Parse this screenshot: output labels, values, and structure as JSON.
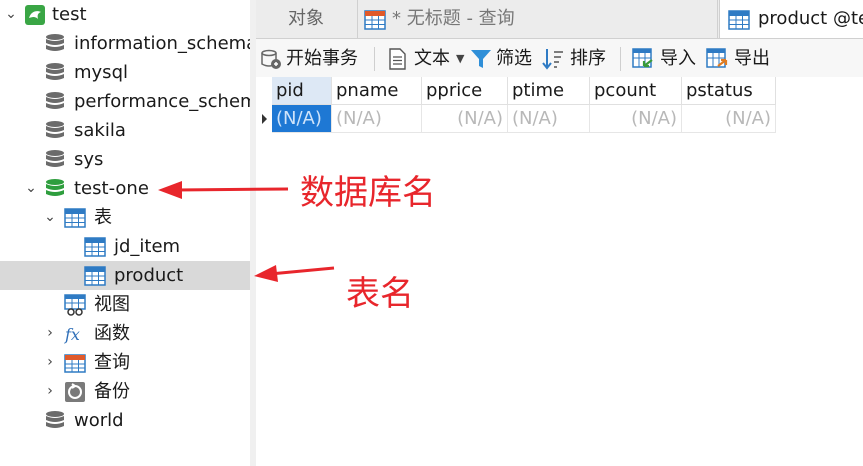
{
  "sidebar": {
    "items": [
      {
        "label": "test"
      },
      {
        "label": "information_schema"
      },
      {
        "label": "mysql"
      },
      {
        "label": "performance_schema"
      },
      {
        "label": "sakila"
      },
      {
        "label": "sys"
      },
      {
        "label": "test-one"
      },
      {
        "label": "表"
      },
      {
        "label": "jd_item"
      },
      {
        "label": "product"
      },
      {
        "label": "视图"
      },
      {
        "label": "函数"
      },
      {
        "label": "查询"
      },
      {
        "label": "备份"
      },
      {
        "label": "world"
      }
    ]
  },
  "tabs": [
    {
      "label": "对象"
    },
    {
      "label": "* 无标题 - 查询"
    },
    {
      "label": "product @te"
    }
  ],
  "toolbar": {
    "begin_transaction": "开始事务",
    "text": "文本",
    "filter": "筛选",
    "sort": "排序",
    "import": "导入",
    "export": "导出"
  },
  "grid": {
    "columns": [
      "pid",
      "pname",
      "pprice",
      "ptime",
      "pcount",
      "pstatus"
    ],
    "row": [
      "(N/A)",
      "(N/A)",
      "(N/A)",
      "(N/A)",
      "(N/A)",
      "(N/A)"
    ]
  },
  "annotations": {
    "database_name": "数据库名",
    "table_name": "表名"
  },
  "colors": {
    "annotation_red": "#e8262c",
    "selection_blue": "#1e78d4",
    "db_green": "#2e9e3e",
    "db_gray": "#6b6b6b"
  }
}
